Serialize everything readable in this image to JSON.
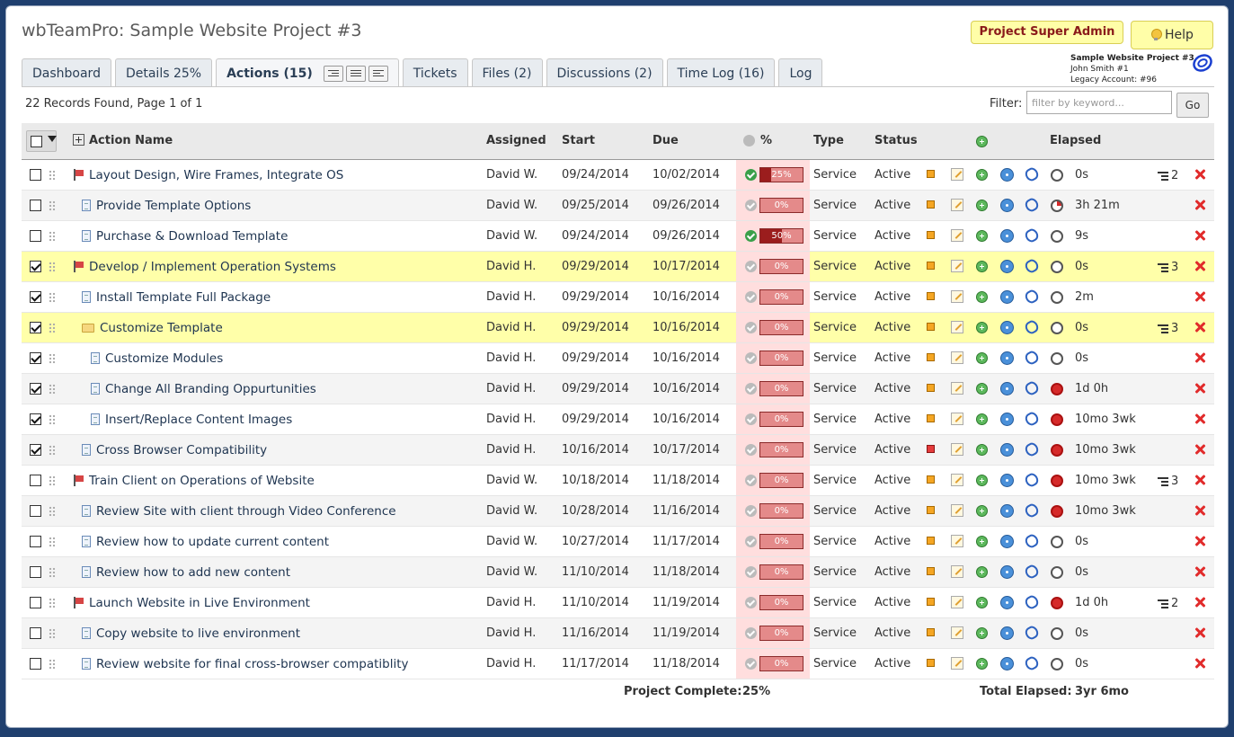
{
  "app": {
    "title": "wbTeamPro: Sample Website Project #3"
  },
  "header": {
    "role_badge": "Project Super Admin",
    "help_label": "Help",
    "project_name": "Sample Website Project #3",
    "user_name": "John Smith #1",
    "account": "Legacy Account: #96"
  },
  "tabs": [
    {
      "label": "Dashboard"
    },
    {
      "label": "Details 25%"
    },
    {
      "label": "Actions (15)"
    },
    {
      "label": "Tickets"
    },
    {
      "label": "Files (2)"
    },
    {
      "label": "Discussions (2)"
    },
    {
      "label": "Time Log (16)"
    },
    {
      "label": "Log"
    }
  ],
  "toolbar": {
    "records": "22 Records Found, Page 1 of 1",
    "filter_label": "Filter:",
    "filter_placeholder": "filter by keyword...",
    "go_label": "Go"
  },
  "columns": {
    "action_name": "Action Name",
    "assigned": "Assigned",
    "start": "Start",
    "due": "Due",
    "pct": "%",
    "type": "Type",
    "status": "Status",
    "elapsed": "Elapsed"
  },
  "rows": [
    {
      "level": 0,
      "icon": "flag",
      "name": "Layout Design, Wire Frames, Integrate OS",
      "assigned": "David W.",
      "start": "09/24/2014",
      "due": "10/02/2014",
      "pct": 25,
      "pct_label": "25%",
      "done": true,
      "type": "Service",
      "status": "Active",
      "flag": "orange",
      "timer": "off",
      "elapsed": "0s",
      "children": "2",
      "checked": false,
      "hl": false
    },
    {
      "level": 1,
      "icon": "doc",
      "name": "Provide Template Options",
      "assigned": "David W.",
      "start": "09/25/2014",
      "due": "09/26/2014",
      "pct": 0,
      "pct_label": "0%",
      "done": false,
      "type": "Service",
      "status": "Active",
      "flag": "orange",
      "timer": "partial",
      "elapsed": "3h 21m",
      "children": "",
      "checked": false,
      "hl": false
    },
    {
      "level": 1,
      "icon": "doc",
      "name": "Purchase & Download Template",
      "assigned": "David W.",
      "start": "09/24/2014",
      "due": "09/26/2014",
      "pct": 50,
      "pct_label": "50%",
      "done": true,
      "type": "Service",
      "status": "Active",
      "flag": "orange",
      "timer": "off",
      "elapsed": "9s",
      "children": "",
      "checked": false,
      "hl": false
    },
    {
      "level": 0,
      "icon": "flag",
      "name": "Develop / Implement Operation Systems",
      "assigned": "David H.",
      "start": "09/29/2014",
      "due": "10/17/2014",
      "pct": 0,
      "pct_label": "0%",
      "done": false,
      "type": "Service",
      "status": "Active",
      "flag": "orange",
      "timer": "off",
      "elapsed": "0s",
      "children": "3",
      "checked": true,
      "hl": true
    },
    {
      "level": 1,
      "icon": "doc",
      "name": "Install Template Full Package",
      "assigned": "David H.",
      "start": "09/29/2014",
      "due": "10/16/2014",
      "pct": 0,
      "pct_label": "0%",
      "done": false,
      "type": "Service",
      "status": "Active",
      "flag": "orange",
      "timer": "off",
      "elapsed": "2m",
      "children": "",
      "checked": true,
      "hl": false
    },
    {
      "level": 1,
      "icon": "folder",
      "name": "Customize Template",
      "assigned": "David H.",
      "start": "09/29/2014",
      "due": "10/16/2014",
      "pct": 0,
      "pct_label": "0%",
      "done": false,
      "type": "Service",
      "status": "Active",
      "flag": "orange",
      "timer": "off",
      "elapsed": "0s",
      "children": "3",
      "checked": true,
      "hl": true
    },
    {
      "level": 2,
      "icon": "doc",
      "name": "Customize Modules",
      "assigned": "David H.",
      "start": "09/29/2014",
      "due": "10/16/2014",
      "pct": 0,
      "pct_label": "0%",
      "done": false,
      "type": "Service",
      "status": "Active",
      "flag": "orange",
      "timer": "off",
      "elapsed": "0s",
      "children": "",
      "checked": true,
      "hl": false
    },
    {
      "level": 2,
      "icon": "doc",
      "name": "Change All Branding Oppurtunities",
      "assigned": "David H.",
      "start": "09/29/2014",
      "due": "10/16/2014",
      "pct": 0,
      "pct_label": "0%",
      "done": false,
      "type": "Service",
      "status": "Active",
      "flag": "orange",
      "timer": "on",
      "elapsed": "1d 0h",
      "children": "",
      "checked": true,
      "hl": false
    },
    {
      "level": 2,
      "icon": "doc",
      "name": "Insert/Replace Content Images",
      "assigned": "David H.",
      "start": "09/29/2014",
      "due": "10/16/2014",
      "pct": 0,
      "pct_label": "0%",
      "done": false,
      "type": "Service",
      "status": "Active",
      "flag": "orange",
      "timer": "on",
      "elapsed": "10mo 3wk",
      "children": "",
      "checked": true,
      "hl": false
    },
    {
      "level": 1,
      "icon": "doc",
      "name": "Cross Browser Compatibility",
      "assigned": "David H.",
      "start": "10/16/2014",
      "due": "10/17/2014",
      "pct": 0,
      "pct_label": "0%",
      "done": false,
      "type": "Service",
      "status": "Active",
      "flag": "red",
      "timer": "on",
      "elapsed": "10mo 3wk",
      "children": "",
      "checked": true,
      "hl": false
    },
    {
      "level": 0,
      "icon": "flag",
      "name": "Train Client on Operations of Website",
      "assigned": "David W.",
      "start": "10/18/2014",
      "due": "11/18/2014",
      "pct": 0,
      "pct_label": "0%",
      "done": false,
      "type": "Service",
      "status": "Active",
      "flag": "orange",
      "timer": "on",
      "elapsed": "10mo 3wk",
      "children": "3",
      "checked": false,
      "hl": false
    },
    {
      "level": 1,
      "icon": "doc",
      "name": "Review Site with client through Video Conference",
      "assigned": "David W.",
      "start": "10/28/2014",
      "due": "11/16/2014",
      "pct": 0,
      "pct_label": "0%",
      "done": false,
      "type": "Service",
      "status": "Active",
      "flag": "orange",
      "timer": "on",
      "elapsed": "10mo 3wk",
      "children": "",
      "checked": false,
      "hl": false
    },
    {
      "level": 1,
      "icon": "doc",
      "name": "Review how to update current content",
      "assigned": "David W.",
      "start": "10/27/2014",
      "due": "11/17/2014",
      "pct": 0,
      "pct_label": "0%",
      "done": false,
      "type": "Service",
      "status": "Active",
      "flag": "orange",
      "timer": "off",
      "elapsed": "0s",
      "children": "",
      "checked": false,
      "hl": false
    },
    {
      "level": 1,
      "icon": "doc",
      "name": "Review how to add new content",
      "assigned": "David W.",
      "start": "11/10/2014",
      "due": "11/18/2014",
      "pct": 0,
      "pct_label": "0%",
      "done": false,
      "type": "Service",
      "status": "Active",
      "flag": "orange",
      "timer": "off",
      "elapsed": "0s",
      "children": "",
      "checked": false,
      "hl": false
    },
    {
      "level": 0,
      "icon": "flag",
      "name": "Launch Website in Live Environment",
      "assigned": "David H.",
      "start": "11/10/2014",
      "due": "11/19/2014",
      "pct": 0,
      "pct_label": "0%",
      "done": false,
      "type": "Service",
      "status": "Active",
      "flag": "orange",
      "timer": "on",
      "elapsed": "1d 0h",
      "children": "2",
      "checked": false,
      "hl": false
    },
    {
      "level": 1,
      "icon": "doc",
      "name": "Copy website to live environment",
      "assigned": "David H.",
      "start": "11/16/2014",
      "due": "11/19/2014",
      "pct": 0,
      "pct_label": "0%",
      "done": false,
      "type": "Service",
      "status": "Active",
      "flag": "orange",
      "timer": "off",
      "elapsed": "0s",
      "children": "",
      "checked": false,
      "hl": false
    },
    {
      "level": 1,
      "icon": "doc",
      "name": "Review website for final cross-browser compatiblity",
      "assigned": "David H.",
      "start": "11/17/2014",
      "due": "11/18/2014",
      "pct": 0,
      "pct_label": "0%",
      "done": false,
      "type": "Service",
      "status": "Active",
      "flag": "orange",
      "timer": "off",
      "elapsed": "0s",
      "children": "",
      "checked": false,
      "hl": false
    }
  ],
  "footer": {
    "complete_label": "Project Complete:",
    "complete_value": "25%",
    "elapsed_label": "Total Elapsed:",
    "elapsed_value": "3yr 6mo"
  },
  "colors": {
    "highlight_row": "#ffffa9",
    "progress_fill": "#9b1d1d",
    "delete": "#e12b2b",
    "role_badge_bg": "#fffea8"
  }
}
